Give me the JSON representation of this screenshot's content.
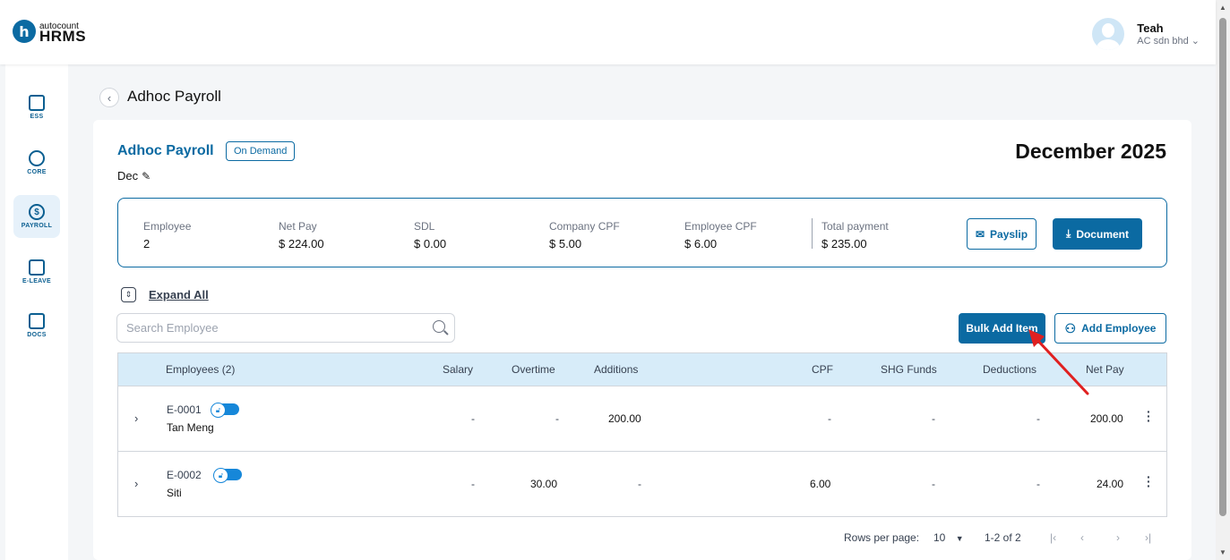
{
  "app": {
    "logo_sub": "autocount",
    "logo_main": "HRMS",
    "logo_letter": "h"
  },
  "user": {
    "name": "Teah",
    "company": "AC sdn bhd"
  },
  "sidebar": {
    "items": [
      {
        "label": "ESS",
        "icon": "id-card-icon"
      },
      {
        "label": "CORE",
        "icon": "cube-icon"
      },
      {
        "label": "PAYROLL",
        "icon": "dollar-circle-icon"
      },
      {
        "label": "E-LEAVE",
        "icon": "calendar-icon"
      },
      {
        "label": "DOCS",
        "icon": "chart-document-icon"
      }
    ]
  },
  "page": {
    "title": "Adhoc Payroll"
  },
  "payroll": {
    "title": "Adhoc Payroll",
    "badge": "On Demand",
    "period": "Dec",
    "month": "December 2025"
  },
  "summary": {
    "employee_label": "Employee",
    "employee_value": "2",
    "netpay_label": "Net Pay",
    "netpay_value": "$ 224.00",
    "sdl_label": "SDL",
    "sdl_value": "$ 0.00",
    "company_cpf_label": "Company CPF",
    "company_cpf_value": "$ 5.00",
    "employee_cpf_label": "Employee CPF",
    "employee_cpf_value": "$ 6.00",
    "total_label": "Total payment",
    "total_value": "$ 235.00",
    "payslip_label": "Payslip",
    "document_label": "Document"
  },
  "toolbar": {
    "expand_label": "Expand All",
    "search_placeholder": "Search Employee",
    "bulk_add_label": "Bulk Add Item",
    "add_employee_label": "Add Employee"
  },
  "table": {
    "headers": {
      "employees": "Employees (2)",
      "salary": "Salary",
      "overtime": "Overtime",
      "additions": "Additions",
      "cpf": "CPF",
      "shg": "SHG Funds",
      "deductions": "Deductions",
      "netpay": "Net Pay"
    },
    "rows": [
      {
        "id": "E-0001",
        "name": "Tan Meng",
        "salary": "-",
        "overtime": "-",
        "additions": "200.00",
        "cpf": "-",
        "shg": "-",
        "deductions": "-",
        "netpay": "200.00"
      },
      {
        "id": "E-0002",
        "name": "Siti",
        "salary": "-",
        "overtime": "30.00",
        "additions": "-",
        "cpf": "6.00",
        "shg": "-",
        "deductions": "-",
        "netpay": "24.00"
      }
    ]
  },
  "pagination": {
    "rows_per_page_label": "Rows per page:",
    "rows_per_page_value": "10",
    "range": "1-2 of 2"
  },
  "colors": {
    "brand": "#0b6aa2",
    "header_bg": "#d7ecf9",
    "annotation": "#e02020"
  }
}
